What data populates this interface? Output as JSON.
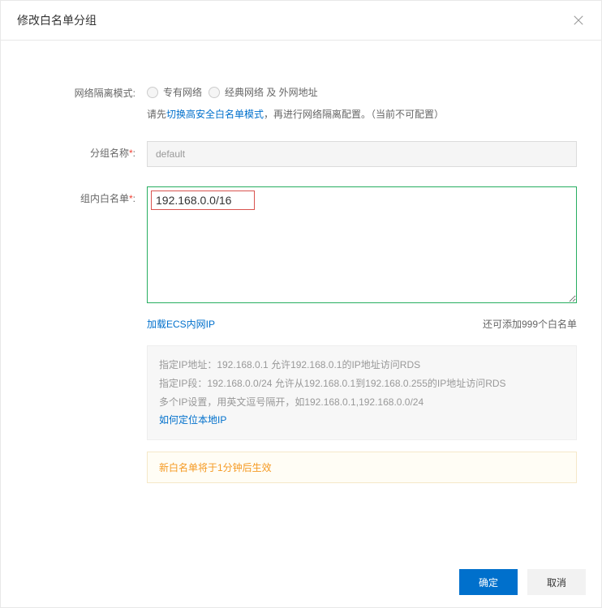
{
  "header": {
    "title": "修改白名单分组"
  },
  "network": {
    "label": "网络隔离模式:",
    "option_vpc": "专有网络",
    "option_classic": "经典网络 及 外网地址",
    "hint_prefix": "请先",
    "hint_link": "切换高安全白名单模式",
    "hint_suffix": "，再进行网络隔离配置。（当前不可配置）"
  },
  "group": {
    "label": "分组名称",
    "value": "default"
  },
  "whitelist": {
    "label": "组内白名单",
    "value": "192.168.0.0/16",
    "load_ecs": "加载ECS内网IP",
    "remaining": "还可添加999个白名单"
  },
  "help": {
    "line1": "指定IP地址：192.168.0.1 允许192.168.0.1的IP地址访问RDS",
    "line2": "指定IP段：192.168.0.0/24 允许从192.168.0.1到192.168.0.255的IP地址访问RDS",
    "line3": "多个IP设置，用英文逗号隔开，如192.168.0.1,192.168.0.0/24",
    "locate_link": "如何定位本地IP"
  },
  "effect_notice": "新白名单将于1分钟后生效",
  "footer": {
    "confirm": "确定",
    "cancel": "取消"
  }
}
